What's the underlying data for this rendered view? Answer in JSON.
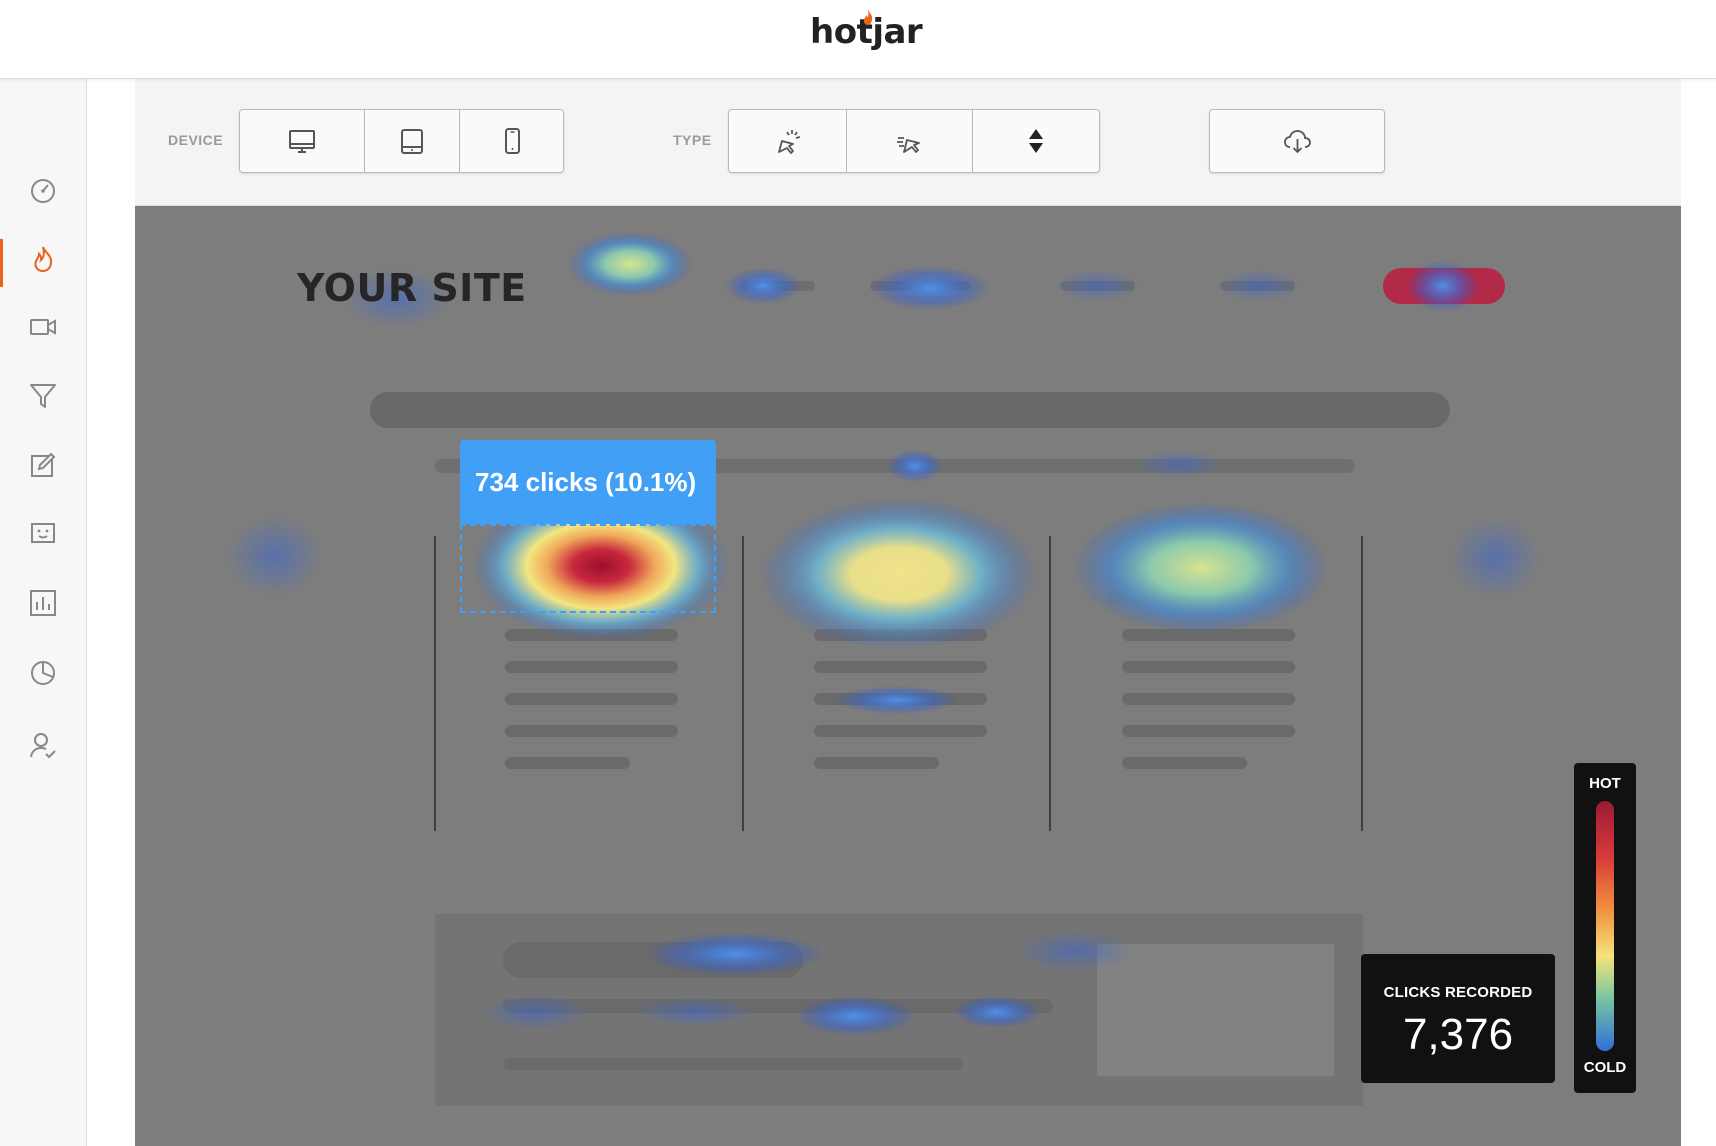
{
  "app": {
    "logo": "hotjar"
  },
  "sidebar": {
    "items": [
      {
        "icon": "dashboard-gauge-icon",
        "active": false
      },
      {
        "icon": "heatmap-flame-icon",
        "active": true
      },
      {
        "icon": "recordings-video-icon",
        "active": false
      },
      {
        "icon": "funnels-filter-icon",
        "active": false
      },
      {
        "icon": "forms-edit-icon",
        "active": false
      },
      {
        "icon": "polls-icon",
        "active": false
      },
      {
        "icon": "analytics-bar-chart-icon",
        "active": false
      },
      {
        "icon": "surveys-pie-chart-icon",
        "active": false
      },
      {
        "icon": "recruiters-user-check-icon",
        "active": false
      }
    ]
  },
  "toolbar": {
    "device_label": "DEVICE",
    "type_label": "TYPE",
    "device_buttons": [
      "desktop-icon",
      "tablet-icon",
      "phone-icon"
    ],
    "type_buttons": [
      "click-icon",
      "move-icon",
      "scroll-icon"
    ],
    "download_button": "cloud-download-icon"
  },
  "heatmap": {
    "site_title": "YOUR SITE",
    "tooltip": "734 clicks (10.1%)",
    "clicks_recorded_label": "CLICKS RECORDED",
    "clicks_recorded_value": "7,376",
    "legend_hot": "HOT",
    "legend_cold": "COLD",
    "colors": {
      "accent": "#41a0f5",
      "active_nav": "#e8641b",
      "overlay": "#7d7d7d"
    }
  }
}
